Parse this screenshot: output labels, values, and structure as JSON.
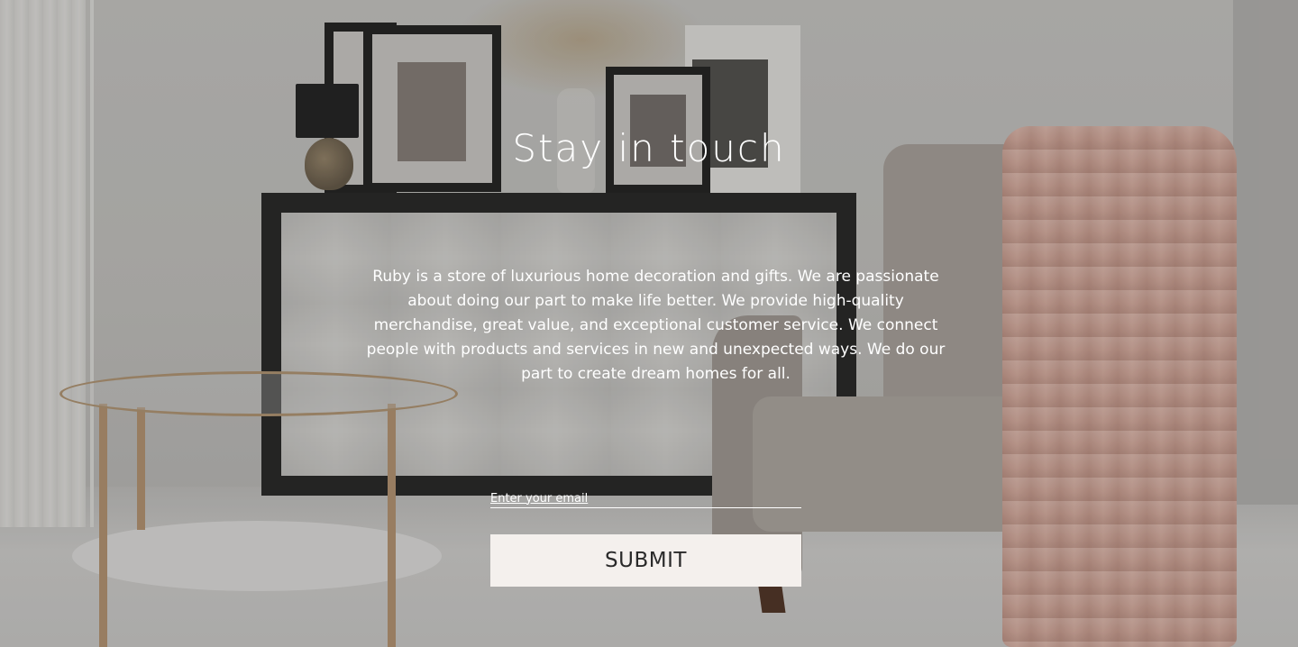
{
  "newsletter": {
    "title": "Stay in touch",
    "description": "Ruby is a store of luxurious home decoration and gifts. We are passionate about doing our part to make life better. We provide high-quality merchandise, great value, and exceptional customer service. We connect people with products and services in new and unexpected ways. We do our part to create dream homes for all.",
    "email_placeholder": "Enter your email",
    "email_value": "",
    "submit_label": "SUBMIT"
  },
  "colors": {
    "text": "#ffffff",
    "button_background": "#f4f0ed",
    "button_text": "#2a2a2a"
  }
}
